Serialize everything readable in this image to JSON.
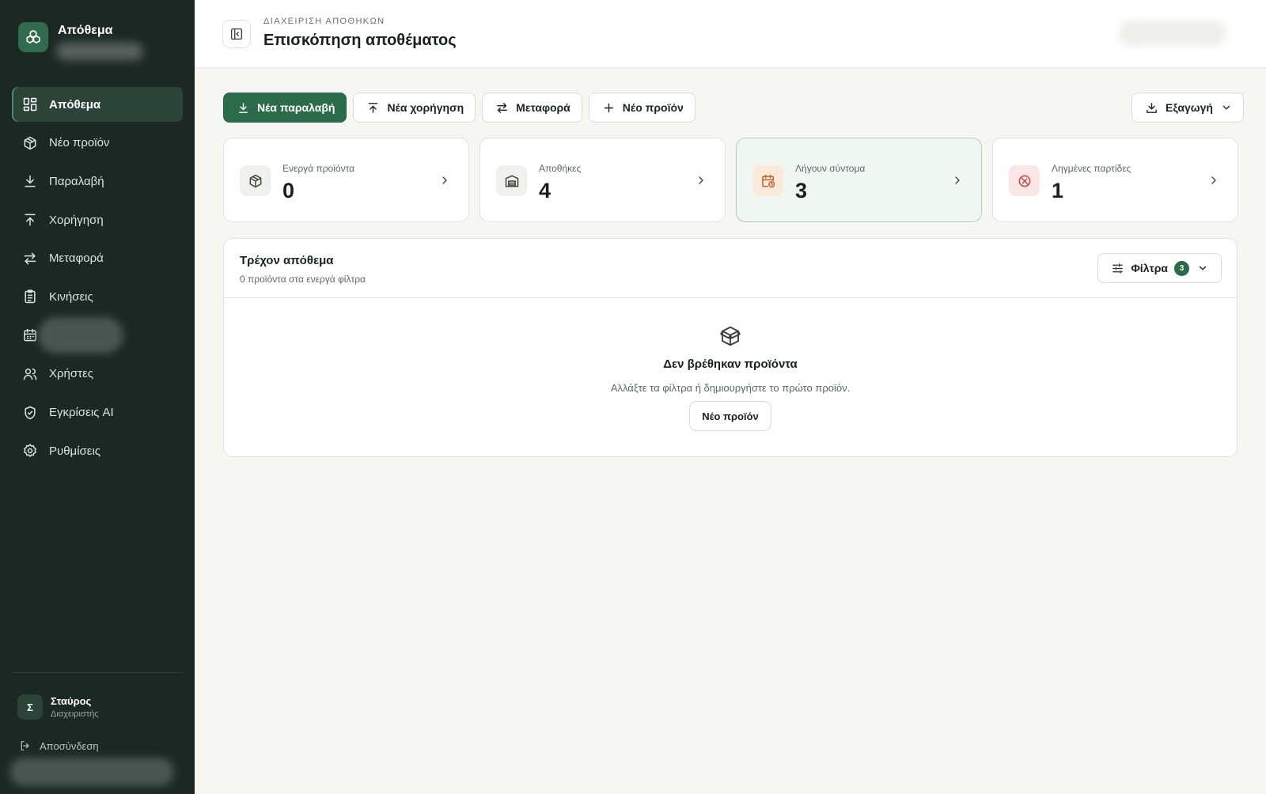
{
  "sidebar": {
    "brand_title": "Απόθεμα",
    "nav": [
      {
        "label": "Απόθεμα",
        "icon": "grid-icon",
        "active": true
      },
      {
        "label": "Νέο προϊόν",
        "icon": "package-plus-icon"
      },
      {
        "label": "Παραλαβή",
        "icon": "download-icon"
      },
      {
        "label": "Χορήγηση",
        "icon": "upload-icon"
      },
      {
        "label": "Μεταφορά",
        "icon": "arrows-swap-icon"
      },
      {
        "label": "Κινήσεις",
        "icon": "clipboard-list-icon"
      },
      {
        "label": "",
        "icon": "calendar-icon",
        "redacted": true
      },
      {
        "label": "Χρήστες",
        "icon": "users-icon"
      },
      {
        "label": "Εγκρίσεις AI",
        "icon": "shield-check-icon"
      },
      {
        "label": "Ρυθμίσεις",
        "icon": "gear-icon"
      }
    ],
    "user": {
      "initial": "Σ",
      "name": "Σταύρος",
      "role": "Διαχειριστής"
    },
    "logout_label": "Αποσύνδεση"
  },
  "header": {
    "eyebrow": "ΔΙΑΧΕΙΡΙΣΗ ΑΠΟΘΗΚΩΝ",
    "title": "Επισκόπηση αποθέματος"
  },
  "toolbar": {
    "new_receipt": "Νέα παραλαβή",
    "new_dispense": "Νέα χορήγηση",
    "transfer": "Μεταφορά",
    "new_product": "Νέο προϊόν",
    "export": "Εξαγωγή"
  },
  "stats": [
    {
      "label": "Ενεργά προϊόντα",
      "value": "0"
    },
    {
      "label": "Αποθήκες",
      "value": "4"
    },
    {
      "label": "Λήγουν σύντομα",
      "value": "3"
    },
    {
      "label": "Ληγμένες παρτίδες",
      "value": "1"
    }
  ],
  "panel": {
    "title": "Τρέχον απόθεμα",
    "subtitle": "0 προϊόντα στα ενεργά φίλτρα",
    "filter_label": "Φίλτρα",
    "filter_count": "3",
    "empty_title": "Δεν βρέθηκαν προϊόντα",
    "empty_text": "Αλλάξτε τα φίλτρα ή δημιουργήστε το πρώτο προϊόν.",
    "empty_button": "Νέο προϊόν"
  },
  "colors": {
    "sidebar_bg": "#1c2824",
    "primary": "#2b6b49",
    "accent_orange": "#c2622a",
    "accent_red": "#c24848"
  }
}
